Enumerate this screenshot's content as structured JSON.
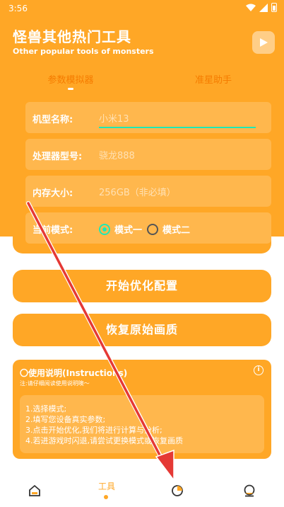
{
  "status_bar": {
    "time": "3:56"
  },
  "header": {
    "title": "怪兽其他热门工具",
    "subtitle": "Other popular tools of monsters"
  },
  "tabs": [
    {
      "label": "参数模拟器",
      "active": true
    },
    {
      "label": "准星助手",
      "active": false
    }
  ],
  "form": {
    "model": {
      "label": "机型名称:",
      "value": "小米13"
    },
    "processor": {
      "label": "处理器型号:",
      "placeholder": "骁龙888"
    },
    "memory": {
      "label": "内存大小:",
      "placeholder": "256GB（非必填）"
    },
    "mode": {
      "label": "当前模式:",
      "options": [
        {
          "label": "模式一",
          "selected": true
        },
        {
          "label": "模式二",
          "selected": false
        }
      ]
    }
  },
  "buttons": {
    "optimize": "开始优化配置",
    "restore": "恢复原始画质"
  },
  "instructions": {
    "title": "〇使用说明(Instructions)",
    "note": "注:请仔细阅读使用说明噢～",
    "steps": [
      "1.选择模式;",
      "2.填写您设备真实参数;",
      "3.点击开始优化,我们将进行计算与分析;",
      "4.若进游戏时闪退,请尝试更换模式或恢复画质"
    ]
  },
  "bottom_nav": {
    "active_label": "工具",
    "items": [
      "home-icon",
      "tools-tab",
      "chart-icon",
      "profile-icon"
    ]
  },
  "colors": {
    "primary": "#FFA726",
    "field_bg": "#FFB74D",
    "accent": "#1DE9B6",
    "annotation_arrow": "#E53935"
  }
}
